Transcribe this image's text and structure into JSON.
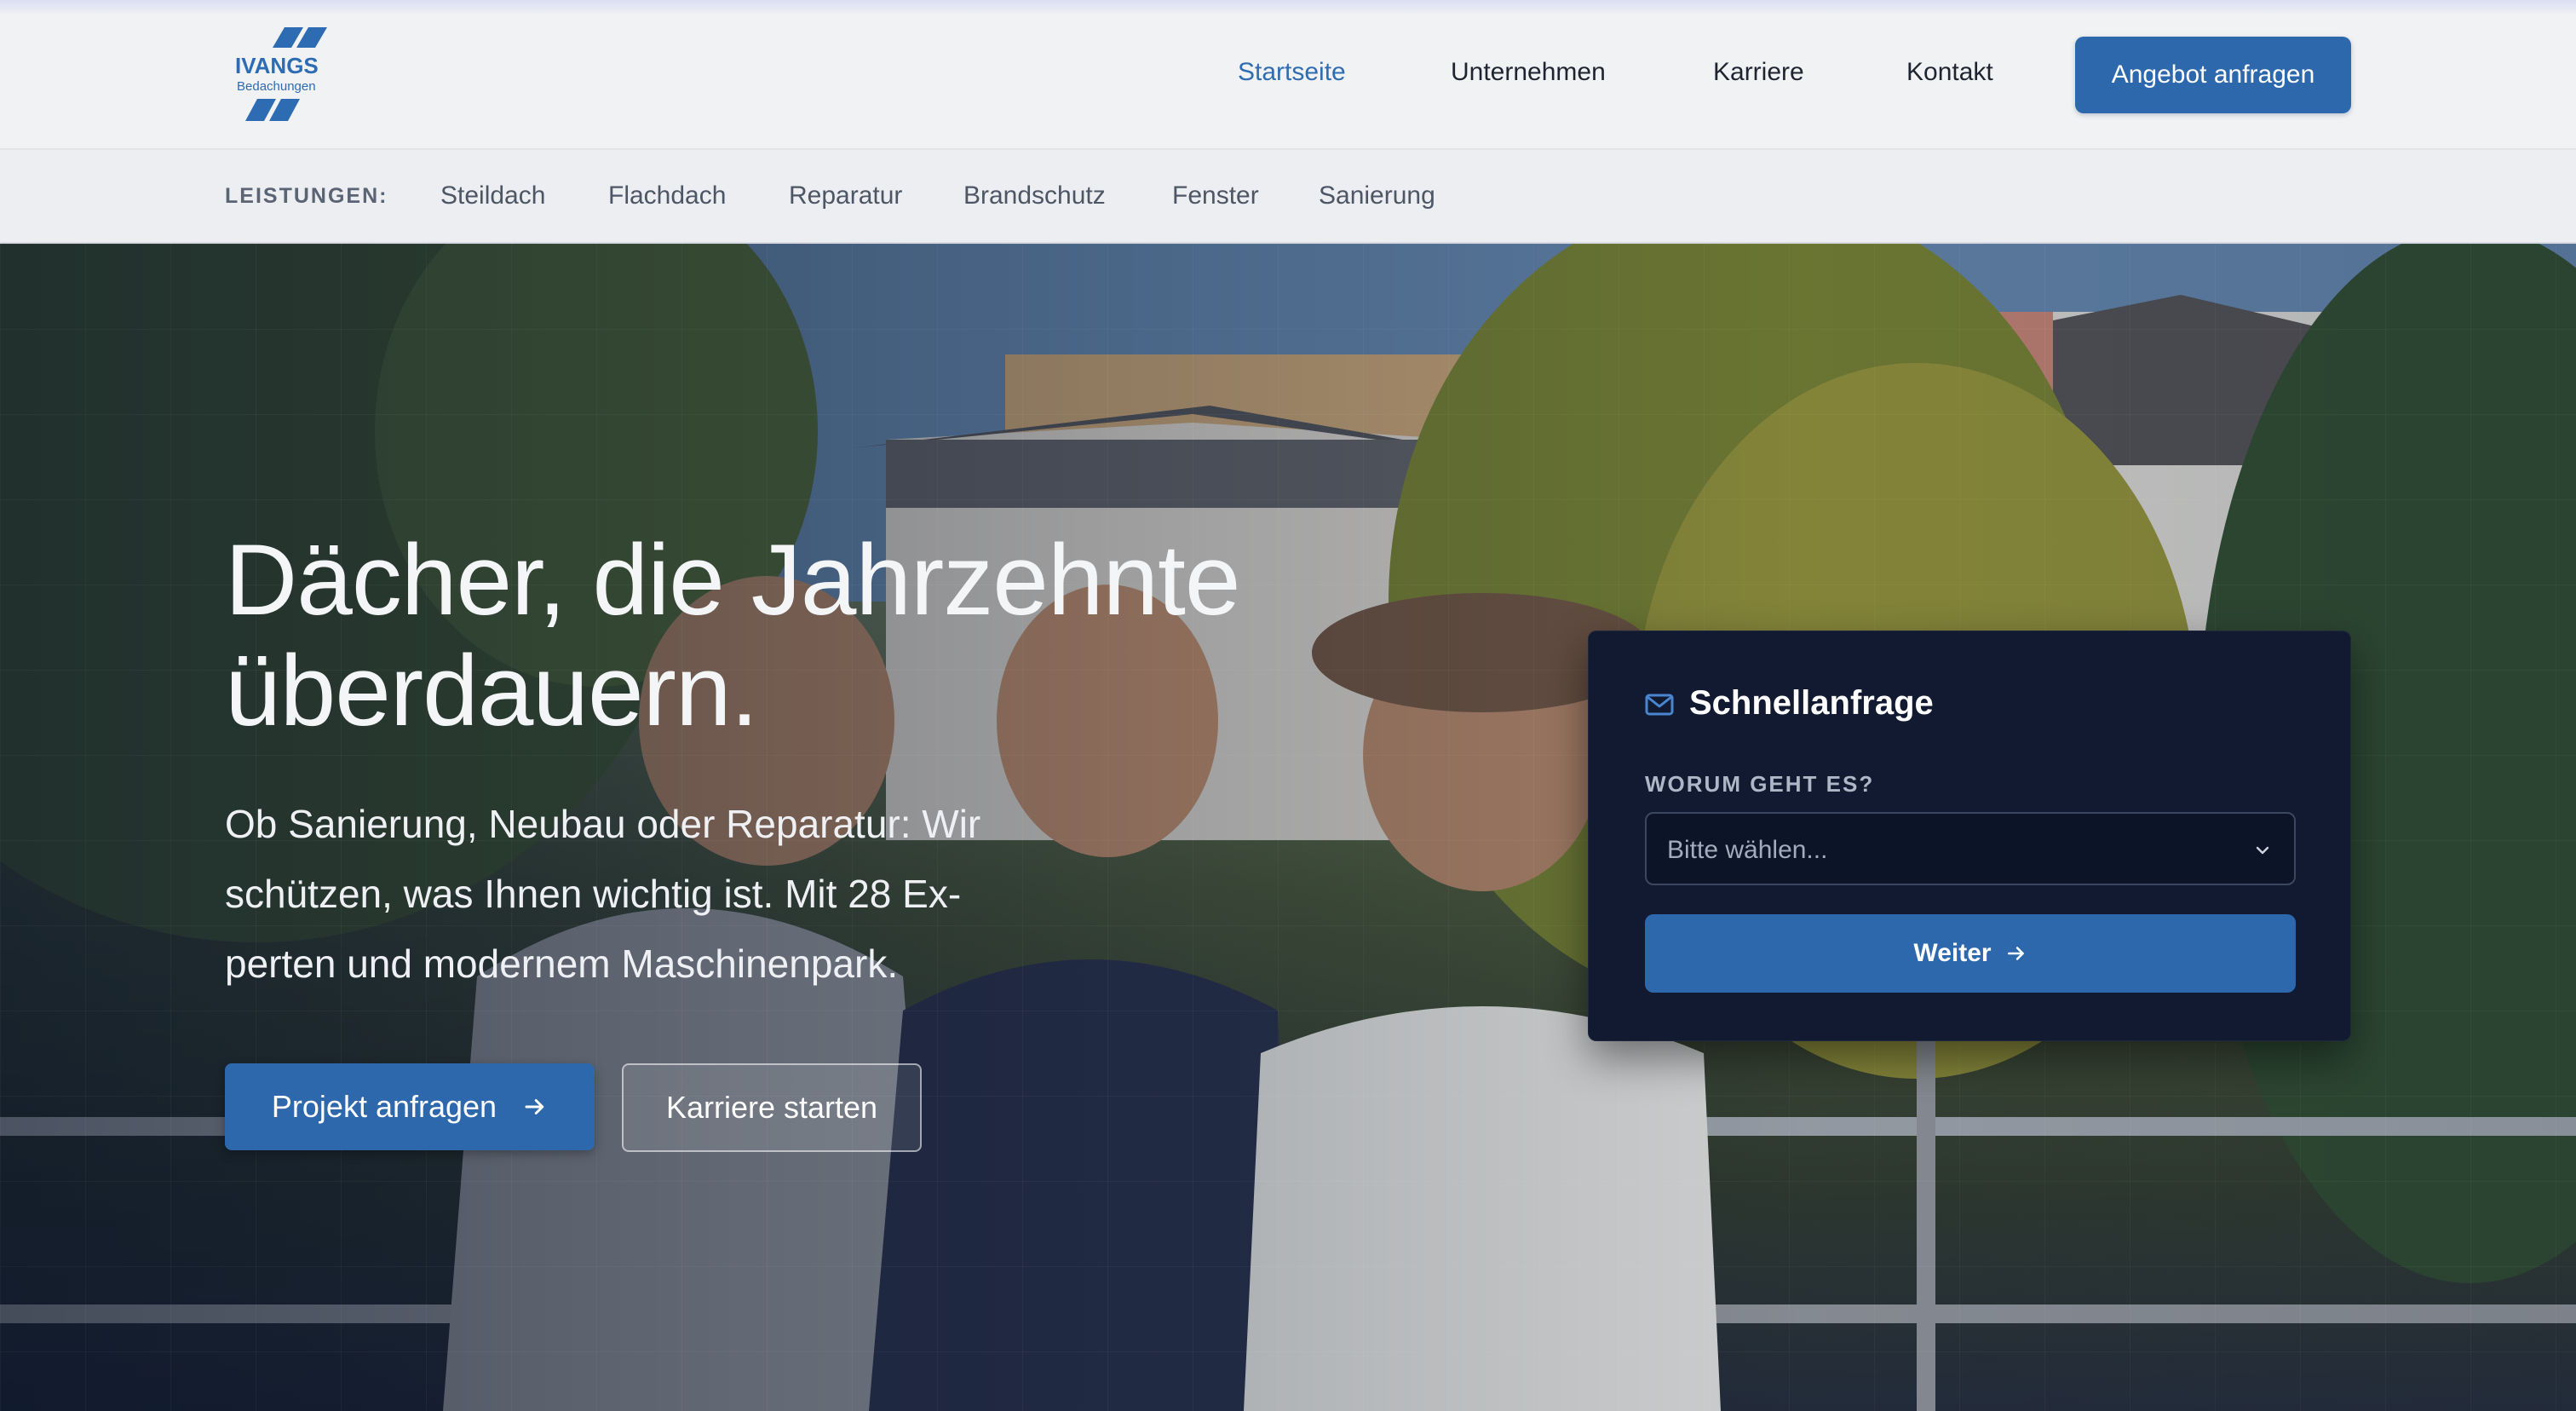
{
  "header": {
    "logo": {
      "brand": "IVANGS",
      "tagline": "Bedachungen"
    },
    "nav": [
      {
        "label": "Startseite",
        "active": true
      },
      {
        "label": "Unternehmen",
        "active": false
      },
      {
        "label": "Karriere",
        "active": false
      },
      {
        "label": "Kontakt",
        "active": false
      }
    ],
    "cta_label": "Angebot anfragen"
  },
  "services": {
    "label": "LEISTUNGEN:",
    "items": [
      "Steildach",
      "Flachdach",
      "Reparatur",
      "Brandschutz",
      "Fenster",
      "Sanierung"
    ]
  },
  "hero": {
    "title_line1": "Dächer, die Jahrzehnte",
    "title_line2": "überdauern.",
    "subtitle_line1": "Ob Sanierung, Neubau oder Reparatur: Wir",
    "subtitle_line2": "schützen, was Ihnen wichtig ist. Mit 28 Ex-",
    "subtitle_line3": "perten und modernem Maschinenpark.",
    "primary_button": "Projekt anfragen",
    "secondary_button": "Karriere starten"
  },
  "quick_request": {
    "title": "Schnellanfrage",
    "field_label": "WORUM GEHT ES?",
    "select_placeholder": "Bitte wählen...",
    "submit_label": "Weiter"
  },
  "colors": {
    "accent": "#2d68ad",
    "nav_active": "#2f6db0",
    "card_bg": "#111a30"
  },
  "icons": [
    "logo-mark-icon",
    "mail-icon",
    "chevron-down-icon",
    "arrow-right-icon"
  ]
}
